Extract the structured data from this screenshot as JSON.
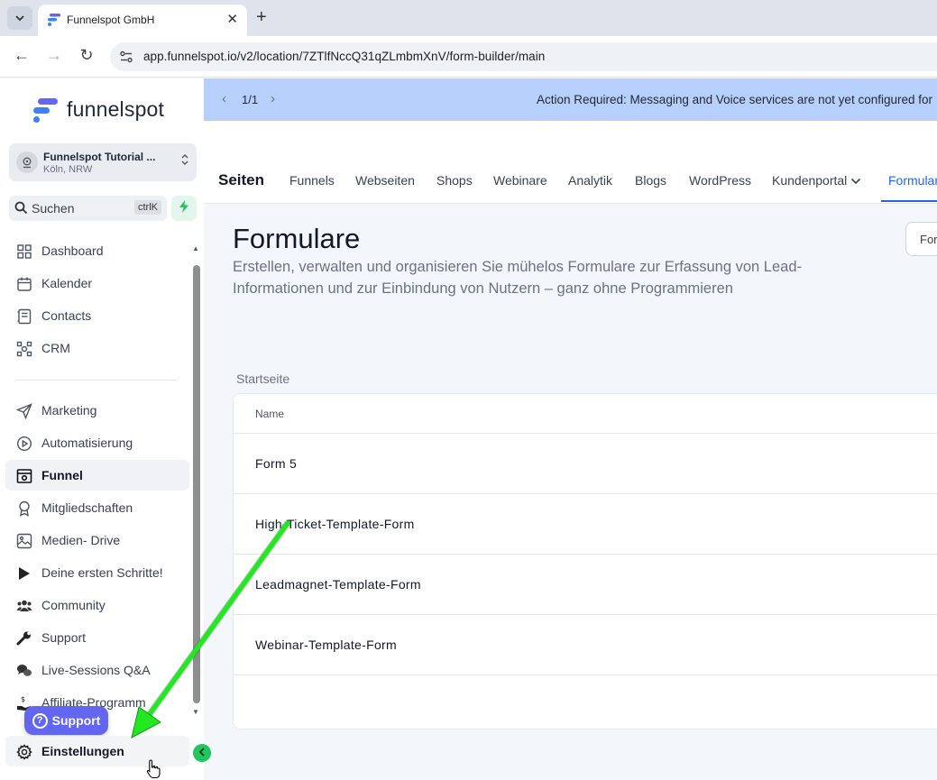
{
  "browser": {
    "tab_title": "Funnelspot GmbH",
    "url": "app.funnelspot.io/v2/location/7ZTlfNccQ31qZLmbmXnV/form-builder/main",
    "tab_menu_icon": "chevron-down-icon",
    "new_tab_label": "+"
  },
  "sidebar": {
    "logo_text": "funnelspot",
    "account": {
      "name": "Funnelspot Tutorial ...",
      "location": "Köln, NRW"
    },
    "search": {
      "label": "Suchen",
      "shortcut": "ctrlK"
    },
    "items": [
      {
        "label": "Dashboard",
        "icon": "dashboard-icon"
      },
      {
        "label": "Kalender",
        "icon": "calendar-icon"
      },
      {
        "label": "Contacts",
        "icon": "contacts-icon"
      },
      {
        "label": "CRM",
        "icon": "crm-icon"
      },
      {
        "label": "Marketing",
        "icon": "send-icon"
      },
      {
        "label": "Automatisierung",
        "icon": "automation-icon"
      },
      {
        "label": "Funnel",
        "icon": "funnel-icon",
        "active": true
      },
      {
        "label": "Mitgliedschaften",
        "icon": "award-icon"
      },
      {
        "label": "Medien- Drive",
        "icon": "image-icon"
      },
      {
        "label": "Deine ersten Schritte!",
        "icon": "play-icon"
      },
      {
        "label": "Community",
        "icon": "users-icon"
      },
      {
        "label": "Support",
        "icon": "wrench-icon"
      },
      {
        "label": "Live-Sessions Q&A",
        "icon": "chat-icon"
      },
      {
        "label": "Affiliate-Programm",
        "icon": "affiliate-icon"
      }
    ],
    "settings_label": "Einstellungen",
    "support_button": "Support"
  },
  "banner": {
    "pager": "1/1",
    "message": "Action Required: Messaging and Voice services are not yet configured for"
  },
  "topnav": {
    "title": "Seiten",
    "items": [
      "Funnels",
      "Webseiten",
      "Shops",
      "Webinare",
      "Analytik",
      "Blogs",
      "WordPress",
      "Kundenportal",
      "Formulare"
    ],
    "active": "Formulare"
  },
  "main": {
    "title": "Formulare",
    "description": "Erstellen, verwalten und organisieren Sie mühelos Formulare zur Erfassung von Lead-Informationen und zur Einbindung von Nutzern – ganz ohne Programmieren",
    "top_button": "For",
    "breadcrumb": "Startseite",
    "table_header": "Name",
    "rows": [
      "Form 5",
      "High-Ticket-Template-Form",
      "Leadmagnet-Template-Form",
      "Webinar-Template-Form"
    ]
  },
  "colors": {
    "accent": "#2563eb",
    "banner": "#b6cffb",
    "support_button": "#6366f1",
    "arrow": "#22e822",
    "collapse": "#22c55e"
  }
}
